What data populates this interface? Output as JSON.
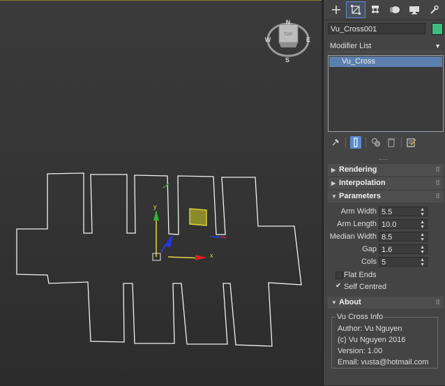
{
  "viewport": {
    "viewcube": {
      "top_label": "TOP",
      "north": "N",
      "south": "S",
      "east": "E",
      "west": "W"
    },
    "gizmo": {
      "x_label": "x",
      "y_label": "y"
    }
  },
  "panel": {
    "tabs": [
      {
        "icon": "create-icon"
      },
      {
        "icon": "modify-icon",
        "active": true
      },
      {
        "icon": "hierarchy-icon"
      },
      {
        "icon": "motion-icon"
      },
      {
        "icon": "display-icon"
      },
      {
        "icon": "utilities-icon"
      }
    ],
    "object_name": "Vu_Cross001",
    "object_color": "#3dbd7d",
    "modifier_list_label": "Modifier List",
    "stack_items": [
      "Vu_Cross"
    ],
    "rollouts": {
      "rendering": "Rendering",
      "interpolation": "Interpolation",
      "parameters": "Parameters",
      "about": "About"
    },
    "params": [
      {
        "label": "Arm Width",
        "value": "5.5"
      },
      {
        "label": "Arm Length",
        "value": "10.0"
      },
      {
        "label": "Median Width",
        "value": "8.5"
      },
      {
        "label": "Gap",
        "value": "1.6"
      },
      {
        "label": "Cols",
        "value": "5"
      }
    ],
    "checkboxes": {
      "flat_ends": {
        "label": "Flat Ends",
        "checked": false
      },
      "self_centred": {
        "label": "Self Centred",
        "checked": true
      }
    },
    "about": {
      "group_title": "Vu Cross Info",
      "lines": [
        "Author: Vu Nguyen",
        "(c) Vu Nguyen 2016",
        "Version: 1.00",
        "Email: vusta@hotmail.com"
      ]
    }
  }
}
